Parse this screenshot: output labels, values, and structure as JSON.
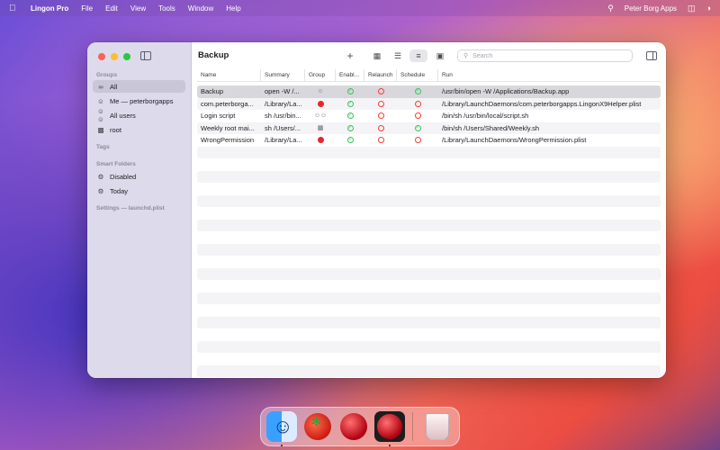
{
  "menubar": {
    "app_name": "Lingon Pro",
    "menus": [
      "File",
      "Edit",
      "View",
      "Tools",
      "Window",
      "Help"
    ],
    "user": "Peter Borg Apps"
  },
  "sidebar": {
    "groups_header": "Groups",
    "groups": [
      {
        "label": "All",
        "icon": "infinity-icon",
        "selected": true
      },
      {
        "label": "Me — peterborgapps",
        "icon": "person-icon"
      },
      {
        "label": "All users",
        "icon": "people-icon"
      },
      {
        "label": "root",
        "icon": "computer-icon"
      }
    ],
    "tags_header": "Tags",
    "smart_header": "Smart Folders",
    "smart": [
      {
        "label": "Disabled",
        "icon": "gear-icon"
      },
      {
        "label": "Today",
        "icon": "gear-icon"
      }
    ],
    "settings_label": "Settings — launchd.plist"
  },
  "toolbar": {
    "title": "Backup",
    "search_placeholder": "Search"
  },
  "table": {
    "columns": [
      "Name",
      "Summary",
      "Group",
      "Enabl...",
      "Relaunch",
      "Schedule",
      "Run"
    ],
    "rows": [
      {
        "name": "Backup",
        "summary": "open -W /...",
        "group": "user",
        "enabled": true,
        "relaunch": false,
        "schedule": true,
        "run": "/usr/bin/open -W /Applications/Backup.app"
      },
      {
        "name": "com.peterborga...",
        "summary": "/Library/La...",
        "group": "root",
        "enabled": true,
        "relaunch": false,
        "schedule": false,
        "run": "/Library/LaunchDaemons/com.peterborgapps.LingonX9Helper.plist"
      },
      {
        "name": "Login script",
        "summary": "sh /usr/bin...",
        "group": "all",
        "enabled": true,
        "relaunch": false,
        "schedule": false,
        "run": "/bin/sh /usr/bin/local/script.sh"
      },
      {
        "name": "Weekly root mai...",
        "summary": "sh /Users/...",
        "group": "computer",
        "enabled": true,
        "relaunch": false,
        "schedule": true,
        "run": "/bin/sh /Users/Shared/Weekly.sh"
      },
      {
        "name": "WrongPermission",
        "summary": "/Library/La...",
        "group": "root",
        "enabled": true,
        "relaunch": false,
        "schedule": false,
        "run": "/Library/LaunchDaemons/WrongPermission.plist"
      }
    ]
  },
  "colors": {
    "enabled_green": "#34c759",
    "disabled_red": "#ff3b30",
    "root_red": "#e8262a"
  }
}
